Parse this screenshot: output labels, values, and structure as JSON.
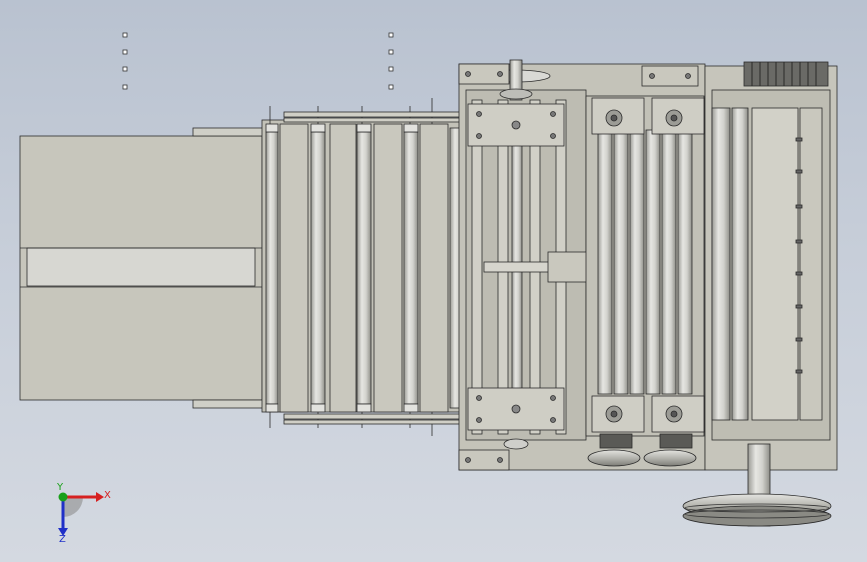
{
  "viewport": {
    "background_top": "#b9c2d0",
    "background_bottom": "#d4d9e1"
  },
  "model": {
    "fill_light": "#c9c8be",
    "fill_mid": "#bebdb2",
    "fill_dark": "#a7a69c",
    "roller": "#d7d7d3",
    "stroke": "#2b2b2b"
  },
  "triad": {
    "x_label": "X",
    "y_label": "Y",
    "z_label": "Z",
    "x_color": "#d62020",
    "y_color": "#1aa01a",
    "z_color": "#2030c8"
  }
}
